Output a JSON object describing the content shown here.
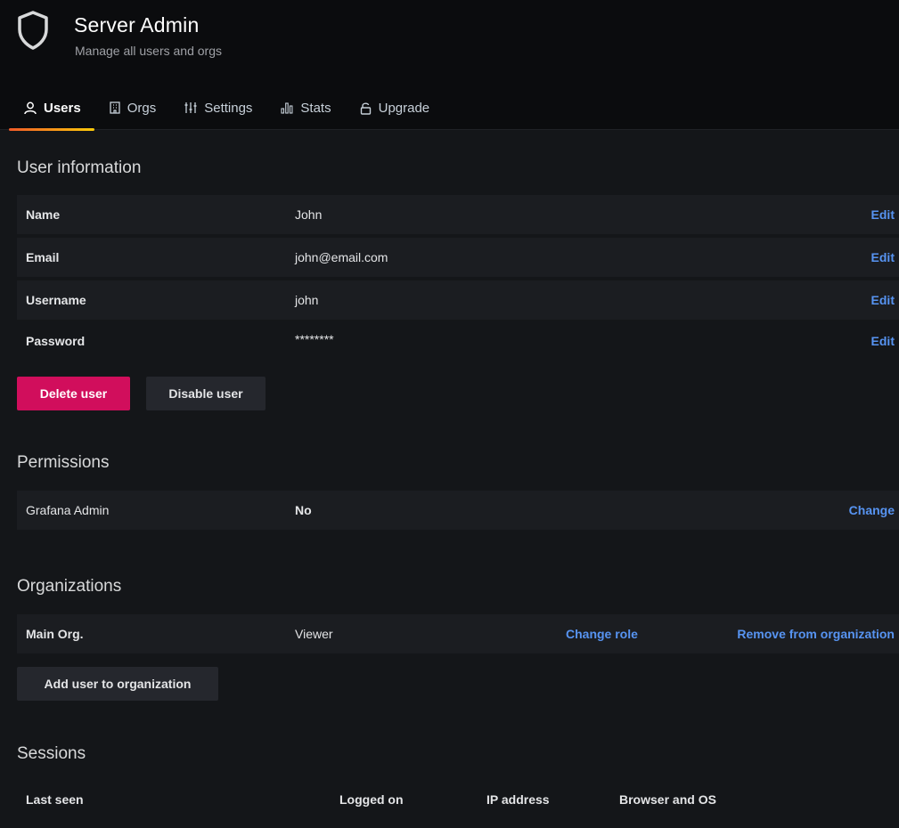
{
  "header": {
    "title": "Server Admin",
    "subtitle": "Manage all users and orgs",
    "icon": "shield-icon"
  },
  "tabs": [
    {
      "label": "Users",
      "icon": "user-icon",
      "active": true
    },
    {
      "label": "Orgs",
      "icon": "building-icon",
      "active": false
    },
    {
      "label": "Settings",
      "icon": "sliders-icon",
      "active": false
    },
    {
      "label": "Stats",
      "icon": "bar-chart-icon",
      "active": false
    },
    {
      "label": "Upgrade",
      "icon": "unlock-icon",
      "active": false
    }
  ],
  "user_information": {
    "title": "User information",
    "rows": [
      {
        "label": "Name",
        "value": "John",
        "action": "Edit"
      },
      {
        "label": "Email",
        "value": "john@email.com",
        "action": "Edit"
      },
      {
        "label": "Username",
        "value": "john",
        "action": "Edit"
      },
      {
        "label": "Password",
        "value": "********",
        "action": "Edit"
      }
    ],
    "delete_label": "Delete user",
    "disable_label": "Disable user"
  },
  "permissions": {
    "title": "Permissions",
    "row": {
      "label": "Grafana Admin",
      "value": "No",
      "action": "Change"
    }
  },
  "organizations": {
    "title": "Organizations",
    "row": {
      "label": "Main Org.",
      "value": "Viewer",
      "change_role": "Change role",
      "remove": "Remove from organization"
    },
    "add_label": "Add user to organization"
  },
  "sessions": {
    "title": "Sessions",
    "columns": [
      "Last seen",
      "Logged on",
      "IP address",
      "Browser and OS"
    ]
  },
  "colors": {
    "accent_link": "#5794f2",
    "danger": "#d10e5c",
    "tab_underline": "#f05a28"
  }
}
